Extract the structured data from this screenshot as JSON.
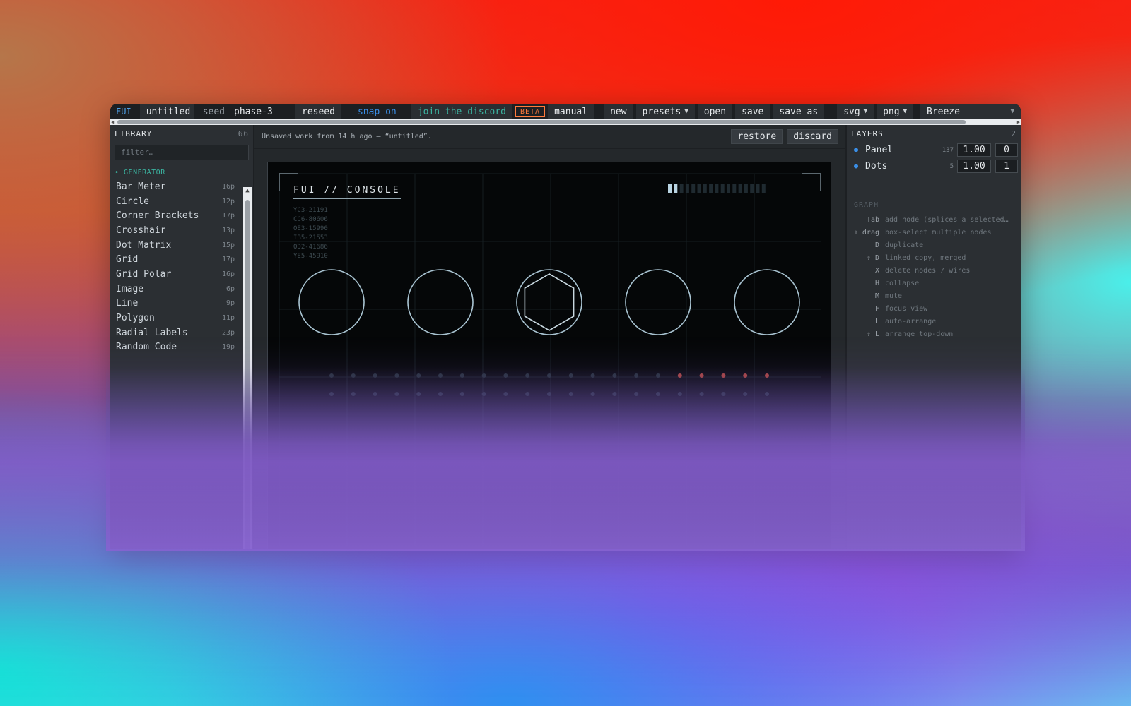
{
  "toolbar": {
    "brand": "FUI",
    "filename": "untitled",
    "seed_label": "seed",
    "seed_value": "phase-3",
    "reseed": "reseed",
    "snap": "snap on",
    "discord": "join the discord",
    "beta": "BETA",
    "manual": "manual",
    "new": "new",
    "presets": "presets",
    "open": "open",
    "save": "save",
    "save_as": "save as",
    "svg": "svg",
    "png": "png",
    "theme": "Breeze"
  },
  "library": {
    "title": "LIBRARY",
    "count": "66",
    "filter_placeholder": "filter…",
    "group": "• GENERATOR",
    "items": [
      {
        "label": "Bar Meter",
        "count": "16p"
      },
      {
        "label": "Circle",
        "count": "12p"
      },
      {
        "label": "Corner Brackets",
        "count": "17p"
      },
      {
        "label": "Crosshair",
        "count": "13p"
      },
      {
        "label": "Dot Matrix",
        "count": "15p"
      },
      {
        "label": "Grid",
        "count": "17p"
      },
      {
        "label": "Grid Polar",
        "count": "16p"
      },
      {
        "label": "Image",
        "count": "6p"
      },
      {
        "label": "Line",
        "count": "9p"
      },
      {
        "label": "Polygon",
        "count": "11p"
      },
      {
        "label": "Radial Labels",
        "count": "23p"
      },
      {
        "label": "Random Code",
        "count": "19p"
      }
    ]
  },
  "notice": {
    "text": "Unsaved work from 14 h ago — “untitled”.",
    "restore": "restore",
    "discard": "discard"
  },
  "canvas": {
    "title": "FUI // CONSOLE",
    "codes": [
      "YC3-21191",
      "CC6-80606",
      "OE3-15990",
      "IB5-21553",
      "QD2-41686",
      "YE5-45910"
    ],
    "meter_lit": 2,
    "meter_total": 17
  },
  "layers": {
    "title": "LAYERS",
    "count": "2",
    "rows": [
      {
        "name": "Panel",
        "count": "137",
        "opacity": "1.00",
        "index": "0"
      },
      {
        "name": "Dots",
        "count": "5",
        "opacity": "1.00",
        "index": "1"
      }
    ],
    "graph_title": "GRAPH",
    "shortcuts": [
      {
        "key": "Tab",
        "desc": "add node (splices a selected…"
      },
      {
        "key": "⇧ drag",
        "desc": "box-select multiple nodes"
      },
      {
        "key": "D",
        "desc": "duplicate"
      },
      {
        "key": "⇧ D",
        "desc": "linked copy, merged"
      },
      {
        "key": "X",
        "desc": "delete nodes / wires"
      },
      {
        "key": "H",
        "desc": "collapse"
      },
      {
        "key": "M",
        "desc": "mute"
      },
      {
        "key": "F",
        "desc": "focus view"
      },
      {
        "key": "L",
        "desc": "auto-arrange"
      },
      {
        "key": "⇧ L",
        "desc": "arrange top-down"
      }
    ]
  },
  "colors": {
    "accent": "#3a8ee6",
    "teal": "#3bb3a0",
    "beta": "#ff7a3d"
  }
}
